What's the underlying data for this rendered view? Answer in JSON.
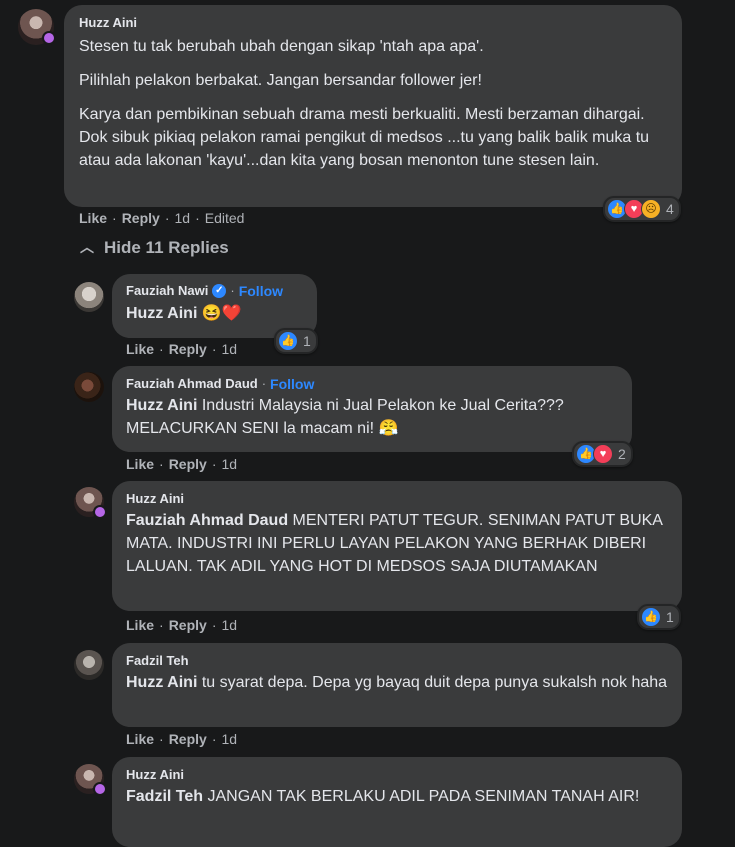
{
  "comments": [
    {
      "author": "Huzz Aini",
      "paragraphs": [
        "Stesen tu tak berubah ubah dengan sikap 'ntah apa apa'.",
        "Pilihlah pelakon berbakat. Jangan bersandar follower jer!",
        "Karya dan pembikinan sebuah drama mesti berkualiti. Mesti berzaman dihargai. Dok sibuk pikiaq pelakon ramai pengikut di medsos ...tu yang balik balik muka tu atau ada lakonan 'kayu'...dan kita yang bosan menonton tune stesen lain."
      ],
      "like": "Like",
      "reply": "Reply",
      "time": "1d",
      "edited": "Edited",
      "reaction_count": "4"
    }
  ],
  "hide_replies": "Hide 11 Replies",
  "replies": [
    {
      "author": "Fauziah Nawi",
      "follow": "Follow",
      "mention": "Huzz Aini",
      "text": "",
      "emoji": "😆❤️",
      "like": "Like",
      "reply": "Reply",
      "time": "1d",
      "reaction_count": "1"
    },
    {
      "author": "Fauziah Ahmad Daud",
      "follow": "Follow",
      "mention": "Huzz Aini",
      "text": "Industri Malaysia ni Jual Pelakon ke Jual Cerita??? MELACURKAN SENI la macam ni! 😤",
      "like": "Like",
      "reply": "Reply",
      "time": "1d",
      "reaction_count": "2"
    },
    {
      "author": "Huzz Aini",
      "mention": "Fauziah Ahmad Daud",
      "text": "MENTERI PATUT TEGUR. SENIMAN PATUT BUKA MATA. INDUSTRI INI PERLU LAYAN PELAKON YANG BERHAK DIBERI LALUAN. TAK ADIL YANG HOT DI MEDSOS SAJA DIUTAMAKAN",
      "like": "Like",
      "reply": "Reply",
      "time": "1d",
      "reaction_count": "1"
    },
    {
      "author": "Fadzil Teh",
      "mention": "Huzz Aini",
      "text": "tu syarat depa. Depa yg bayaq duit depa punya sukalsh nok haha",
      "like": "Like",
      "reply": "Reply",
      "time": "1d"
    },
    {
      "author": "Huzz Aini",
      "mention": "Fadzil Teh",
      "text": "JANGAN TAK BERLAKU ADIL PADA SENIMAN TANAH AIR!"
    }
  ],
  "icons": {
    "verified": "verified-check-icon",
    "like": "like-thumb-icon",
    "love": "love-heart-icon",
    "sad": "sad-face-icon",
    "chevron": "chevron-up-icon"
  },
  "colors": {
    "background": "#18191a",
    "bubble": "#3a3b3c",
    "link": "#2d88ff",
    "muted": "#b0b3b8"
  }
}
